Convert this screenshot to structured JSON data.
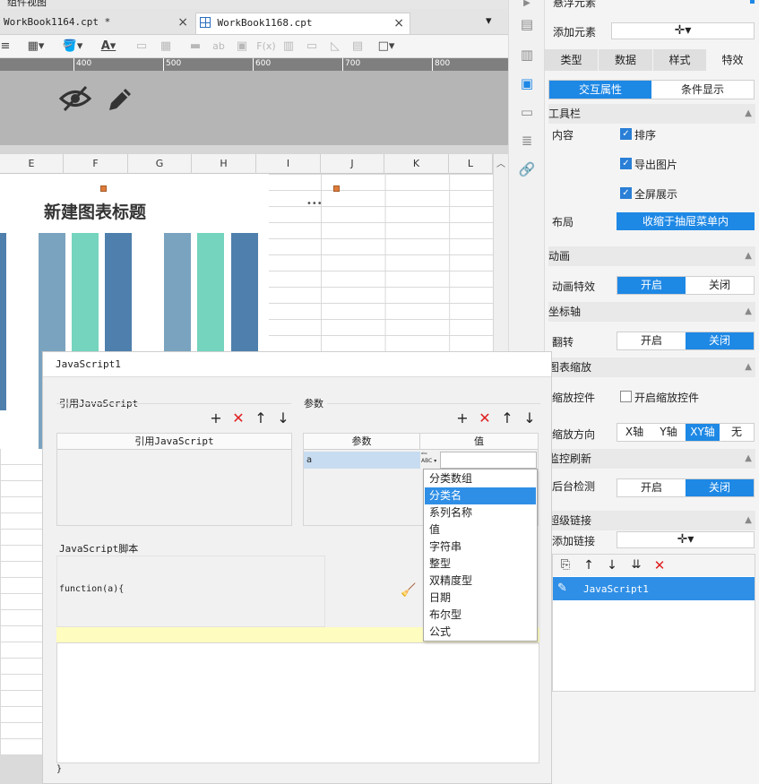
{
  "top_strip": {
    "text": "组件视图"
  },
  "tabs": [
    {
      "label": "WorkBook1164.cpt *",
      "close": "×"
    },
    {
      "label": "WorkBook1168.cpt",
      "close": "×"
    }
  ],
  "ruler_ticks": [
    "400",
    "500",
    "600",
    "700",
    "800"
  ],
  "columns": [
    "E",
    "F",
    "G",
    "H",
    "I",
    "J",
    "K",
    "L"
  ],
  "chart": {
    "title": "新建图表标题",
    "more": "•••"
  },
  "colors": {
    "accent": "#1e88e5",
    "bar_blue": "#4f7fac",
    "bar_teal": "#74d4bd",
    "bar_steel": "#7aa3bf",
    "red": "#e02020"
  },
  "right_panel": {
    "top_label": "悬浮元素",
    "add_element": "添加元素",
    "add_symbol": "✛▾",
    "tabs": [
      "类型",
      "数据",
      "样式",
      "特效"
    ],
    "sub_tabs": [
      "交互属性",
      "条件显示"
    ],
    "toolbar_section": "工具栏",
    "content_label": "内容",
    "checks": [
      "排序",
      "导出图片",
      "全屏展示"
    ],
    "layout_label": "布局",
    "layout_value": "收缩于抽屉菜单内",
    "animation_section": "动画",
    "animation_label": "动画特效",
    "animation_opts": [
      "开启",
      "关闭"
    ],
    "axis_section": "坐标轴",
    "flip_label": "翻转",
    "flip_opts": [
      "开启",
      "关闭"
    ],
    "zoom_section": "图表缩放",
    "zoom_ctrl_label": "缩放控件",
    "zoom_ctrl_check": "开启缩放控件",
    "zoom_dir_label": "缩放方向",
    "zoom_dir_opts": [
      "X轴",
      "Y轴",
      "XY轴",
      "无"
    ],
    "monitor_section": "监控刷新",
    "bg_check_label": "后台检测",
    "bg_check_opts": [
      "开启",
      "关闭"
    ],
    "link_section": "超级链接",
    "add_link_label": "添加链接",
    "link_item": "JavaScript1"
  },
  "dialog": {
    "title": "JavaScript1",
    "ref_js_label": "引用JavaScript",
    "params_label": "参数",
    "ref_js_col": "引用JavaScript",
    "param_col": "参数",
    "value_col": "值",
    "param_row_name": "a",
    "script_label": "JavaScript脚本",
    "fn_open": "function(a){",
    "fn_close": "}",
    "mark_icon_text": "🧹",
    "dropdown": [
      "分类数组",
      "分类名",
      "系列名称",
      "值",
      "字符串",
      "整型",
      "双精度型",
      "日期",
      "布尔型",
      "公式"
    ],
    "dropdown_selected": "分类名"
  }
}
